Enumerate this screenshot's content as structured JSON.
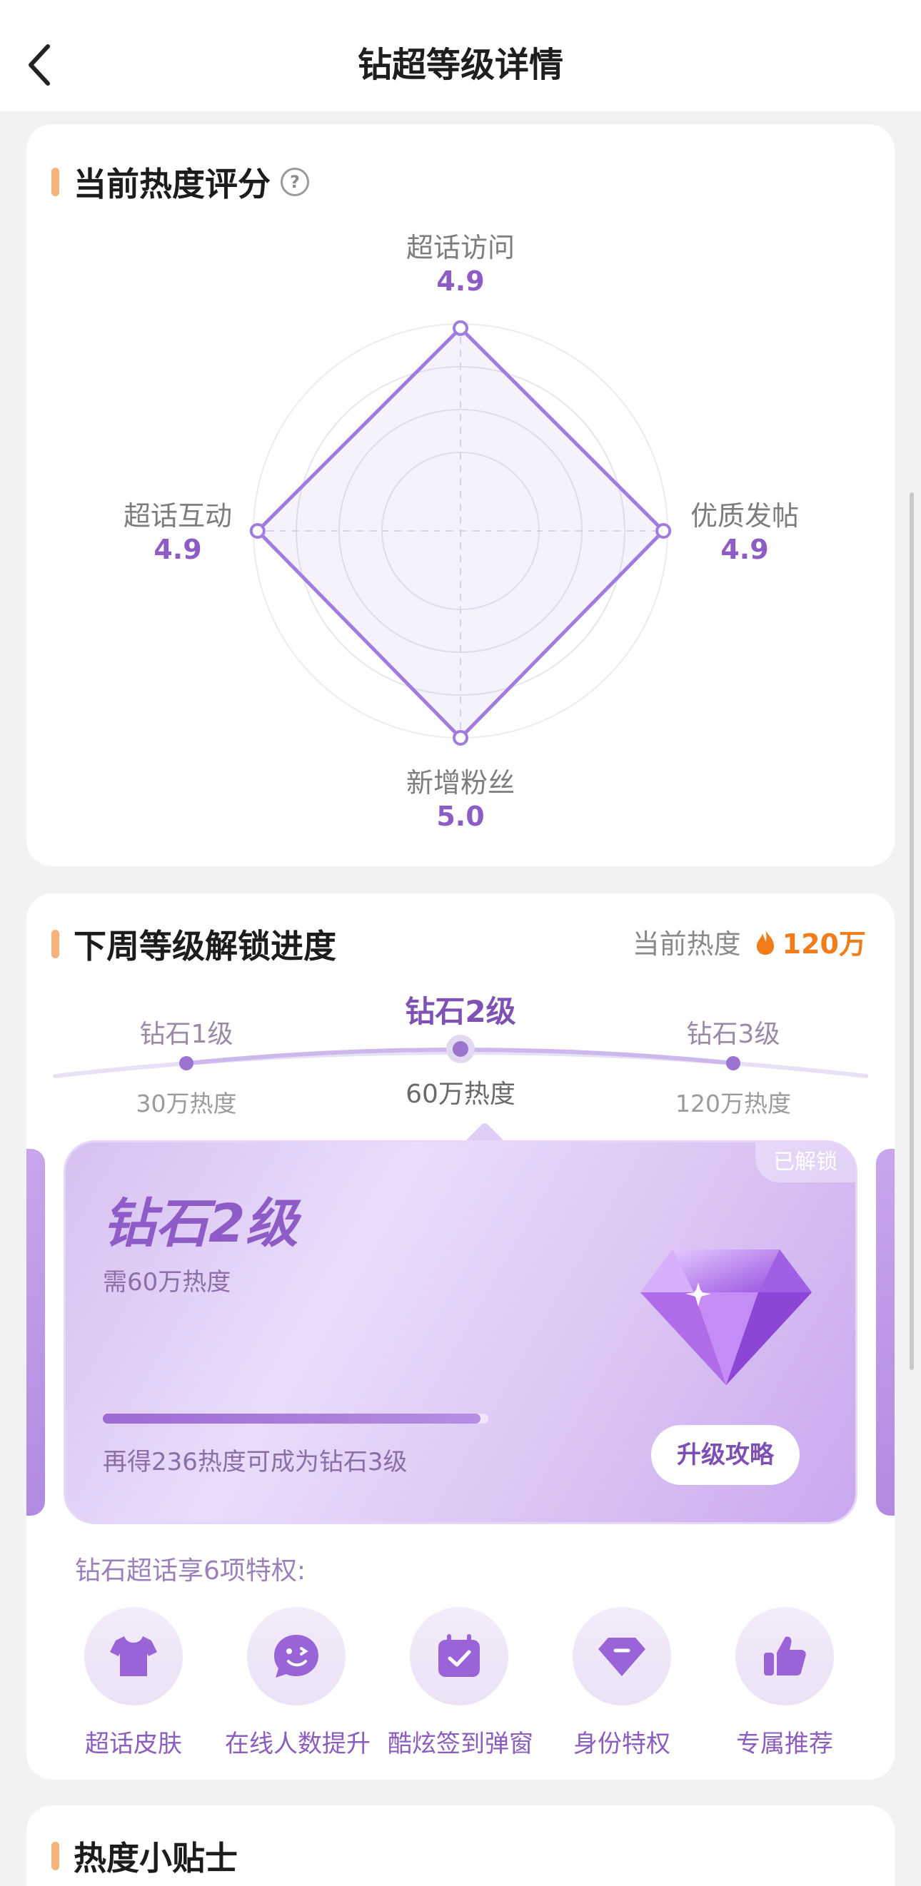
{
  "header": {
    "title": "钻超等级详情"
  },
  "heat_score": {
    "title": "当前热度评分",
    "help": "?",
    "axes": [
      {
        "label": "超话访问",
        "value": "4.9"
      },
      {
        "label": "优质发帖",
        "value": "4.9"
      },
      {
        "label": "新增粉丝",
        "value": "5.0"
      },
      {
        "label": "超话互动",
        "value": "4.9"
      }
    ],
    "radar_values": [
      4.9,
      4.9,
      5.0,
      4.9
    ],
    "radar_max": 5.0
  },
  "progress": {
    "title": "下周等级解锁进度",
    "current_heat_label": "当前热度",
    "current_heat_value": "120万",
    "levels": [
      {
        "name": "钻石1级",
        "heat": "30万热度"
      },
      {
        "name": "钻石2级",
        "heat": "60万热度"
      },
      {
        "name": "钻石3级",
        "heat": "120万热度"
      }
    ],
    "card": {
      "badge": "已解锁",
      "level": "钻石2级",
      "need": "需60万热度",
      "progress_fraction": 0.98,
      "progress_text": "再得236热度可成为钻石3级",
      "button": "升级攻略"
    },
    "privileges_title": "钻石超话享6项特权:",
    "privileges": [
      {
        "label": "超话皮肤",
        "icon": "tshirt-icon"
      },
      {
        "label": "在线人数提升",
        "icon": "smile-chat-icon"
      },
      {
        "label": "酷炫签到弹窗",
        "icon": "calendar-check-icon"
      },
      {
        "label": "身份特权",
        "icon": "diamond-badge-icon"
      },
      {
        "label": "专属推荐",
        "icon": "thumbs-up-icon"
      }
    ]
  },
  "tips": {
    "title": "热度小贴士"
  },
  "colors": {
    "accent": "#8d5cc4",
    "orange": "#f07c1a",
    "title_bar": "#f7b27c"
  }
}
